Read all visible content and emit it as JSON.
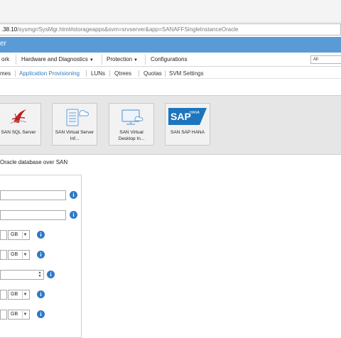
{
  "browser": {
    "url_host_suffix": ".38.10",
    "url_path": "/sysmgr/SysMgr.html#storageapps&svm=srvserver&app=SANAFFSingleInstanceOracle"
  },
  "header": {
    "title": "er"
  },
  "menu": {
    "items": [
      {
        "label": "ork"
      },
      {
        "label": "Hardware and Diagnostics"
      },
      {
        "label": "Protection"
      },
      {
        "label": "Configurations"
      }
    ],
    "scope_select": "All"
  },
  "subnav": {
    "items": [
      {
        "label": "mes"
      },
      {
        "label": "Application Provisioning"
      },
      {
        "label": "LUNs"
      },
      {
        "label": "Qtrees"
      },
      {
        "label": "Quotas"
      },
      {
        "label": "SVM Settings"
      }
    ]
  },
  "templates": [
    {
      "label": "SAN SQL Server",
      "icon": "sql-server-icon"
    },
    {
      "label": "SAN Virtual Server Inf...",
      "icon": "virtual-server-icon"
    },
    {
      "label": "SAN Virtual Desktop In...",
      "icon": "virtual-desktop-icon"
    },
    {
      "label": "SAN SAP HANA",
      "icon": "sap-hana-icon",
      "logo_text": "SAP",
      "logo_sub": "HANA"
    }
  ],
  "section": {
    "title": "Oracle database over SAN"
  },
  "form": {
    "units": [
      "GB",
      "GB",
      "GB",
      "GB"
    ],
    "info_glyph": "i"
  },
  "colors": {
    "accent": "#5b9bd5",
    "link": "#2e7cc2",
    "info": "#2f79c6",
    "sap_blue": "#1d75bd"
  }
}
